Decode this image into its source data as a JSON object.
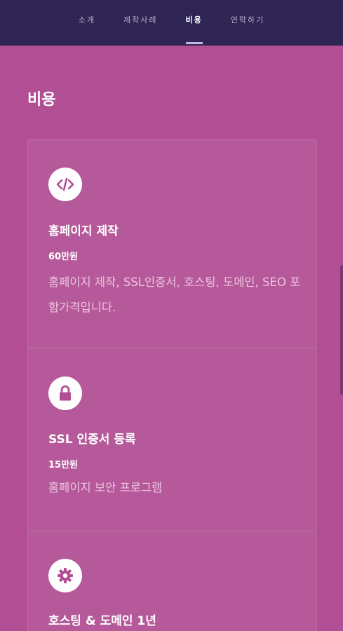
{
  "nav": {
    "tabs": [
      {
        "label": "소개"
      },
      {
        "label": "제작사례"
      },
      {
        "label": "비용"
      },
      {
        "label": "연락하기"
      }
    ],
    "active_index": 2
  },
  "page": {
    "title": "비용"
  },
  "cards": [
    {
      "icon": "code-icon",
      "title": "홈페이지 제작",
      "price": "60만원",
      "desc": "홈페이지 제작, SSL인증서, 호스팅, 도메인, SEO 포함가격입니다."
    },
    {
      "icon": "lock-icon",
      "title": "SSL 인증서 등록",
      "price": "15만원",
      "desc": "홈페이지 보안 프로그램"
    },
    {
      "icon": "gear-icon",
      "title": "호스팅 & 도메인 1년",
      "price": "",
      "desc": ""
    }
  ],
  "colors": {
    "nav_bg": "#2f2555",
    "page_bg": "#b24f94",
    "icon_fg": "#b24f94"
  }
}
